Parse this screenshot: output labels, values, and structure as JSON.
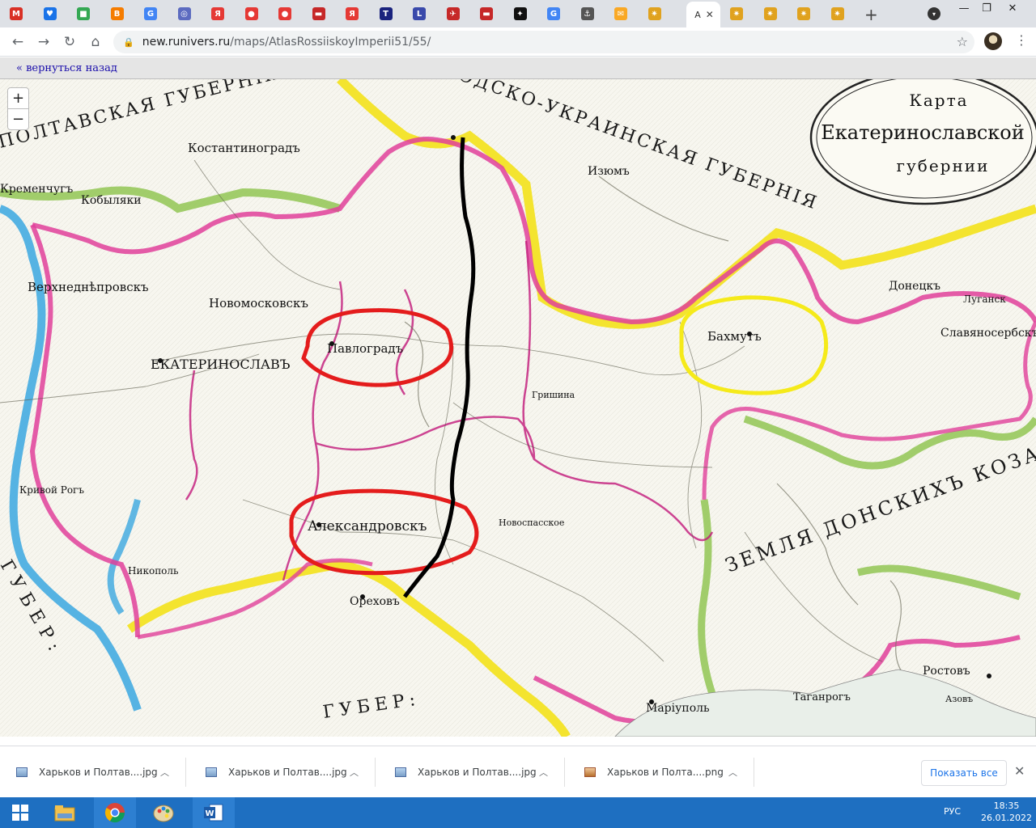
{
  "browser": {
    "tabs": [
      {
        "icon": "M",
        "color": "#d93025",
        "name": "gmail-tab"
      },
      {
        "icon": "♥",
        "color": "#1a73e8",
        "name": "tab-2"
      },
      {
        "icon": "■",
        "color": "#34a853",
        "name": "tab-3"
      },
      {
        "icon": "B",
        "color": "#f57c00",
        "name": "blogger-tab"
      },
      {
        "icon": "G",
        "color": "#4285f4",
        "name": "google-tab"
      },
      {
        "icon": "◎",
        "color": "#5c6bc0",
        "name": "tab-6"
      },
      {
        "icon": "Я",
        "color": "#e53935",
        "name": "yandex-tab"
      },
      {
        "icon": "●",
        "color": "#e53935",
        "name": "maps-tab"
      },
      {
        "icon": "●",
        "color": "#e53935",
        "name": "maps-tab-2"
      },
      {
        "icon": "▬",
        "color": "#c62828",
        "name": "tab-10"
      },
      {
        "icon": "Я",
        "color": "#e53935",
        "name": "yandex-tab-2"
      },
      {
        "icon": "T",
        "color": "#1a237e",
        "name": "tab-12"
      },
      {
        "icon": "L",
        "color": "#3949ab",
        "name": "tab-13"
      },
      {
        "icon": "✈",
        "color": "#c62828",
        "name": "tab-14"
      },
      {
        "icon": "▬",
        "color": "#c62828",
        "name": "tab-15"
      },
      {
        "icon": "✦",
        "color": "#111111",
        "name": "tab-16"
      },
      {
        "icon": "G",
        "color": "#4285f4",
        "name": "google-tab-2"
      },
      {
        "icon": "⚓",
        "color": "#555555",
        "name": "tab-18"
      },
      {
        "icon": "✉",
        "color": "#f9a825",
        "name": "mail-tab"
      },
      {
        "icon": "✷",
        "color": "#e0a21f",
        "name": "tab-20"
      }
    ],
    "active_tab_label": "A",
    "trailing_tabs": [
      {
        "icon": "✷",
        "color": "#e0a21f"
      },
      {
        "icon": "✷",
        "color": "#e0a21f"
      },
      {
        "icon": "✷",
        "color": "#e0a21f"
      },
      {
        "icon": "✷",
        "color": "#e0a21f"
      }
    ],
    "new_tab": "+",
    "url_host": "new.runivers.ru",
    "url_path": "/maps/AtlasRossiiskoyImperii51/55/"
  },
  "page": {
    "back_link": "« вернуться назад",
    "zoom_in": "+",
    "zoom_out": "−"
  },
  "map": {
    "cartouche": [
      "Карта",
      "Екатеринославской",
      "губернии"
    ],
    "labels": {
      "poltava_gub": "ПОЛТАВСКАЯ ГУБЕРНІЯ",
      "slobodsko": "ОДСКО-УКРАИНСКАЯ ГУБЕРНІЯ",
      "kostantinograd": "Костантиноградъ",
      "izyum": "Изюмъ",
      "kremenchug": "Кременчугъ",
      "kobylyaki": "Кобыляки",
      "verkhnedneprovsk": "Верхнеднѣпровскъ",
      "novomoskovsk": "Новомосковскъ",
      "pavlograd": "Павлоградъ",
      "ekaterinoslav": "ЕКАТЕРИНОСЛАВЪ",
      "aleksandrovsk": "Александровскъ",
      "bakhmut": "Бахмутъ",
      "slavyanoserbsk": "Славяносербскъ",
      "donetsk": "Донецкъ",
      "mariupol": "Маріуполь",
      "rostov": "Ростовъ",
      "taganrog": "Таганрогъ",
      "orekhov": "Ореховъ",
      "zemlya": "ЗЕМЛЯ ДОНСКИХЪ КОЗАКОВЪ",
      "tavr_gub": "ГУБЕР:",
      "kher_gub": "ГУБЕР:",
      "lugansk": "Луганск",
      "krivoy_rog": "Кривой Рогъ",
      "nikopol": "Никополь",
      "novopolye": "Новоспасское",
      "grishino": "Гришина",
      "azov": "Азовъ"
    }
  },
  "downloads": {
    "items": [
      {
        "name": "Харьков и Полтав....jpg",
        "type": "jpg"
      },
      {
        "name": "Харьков и Полтав....jpg",
        "type": "jpg"
      },
      {
        "name": "Харьков и Полтав....jpg",
        "type": "jpg"
      },
      {
        "name": "Харьков и Полта....png",
        "type": "png"
      }
    ],
    "show_all": "Показать все"
  },
  "taskbar": {
    "lang": "РУС",
    "time": "18:35",
    "date": "26.01.2022"
  }
}
